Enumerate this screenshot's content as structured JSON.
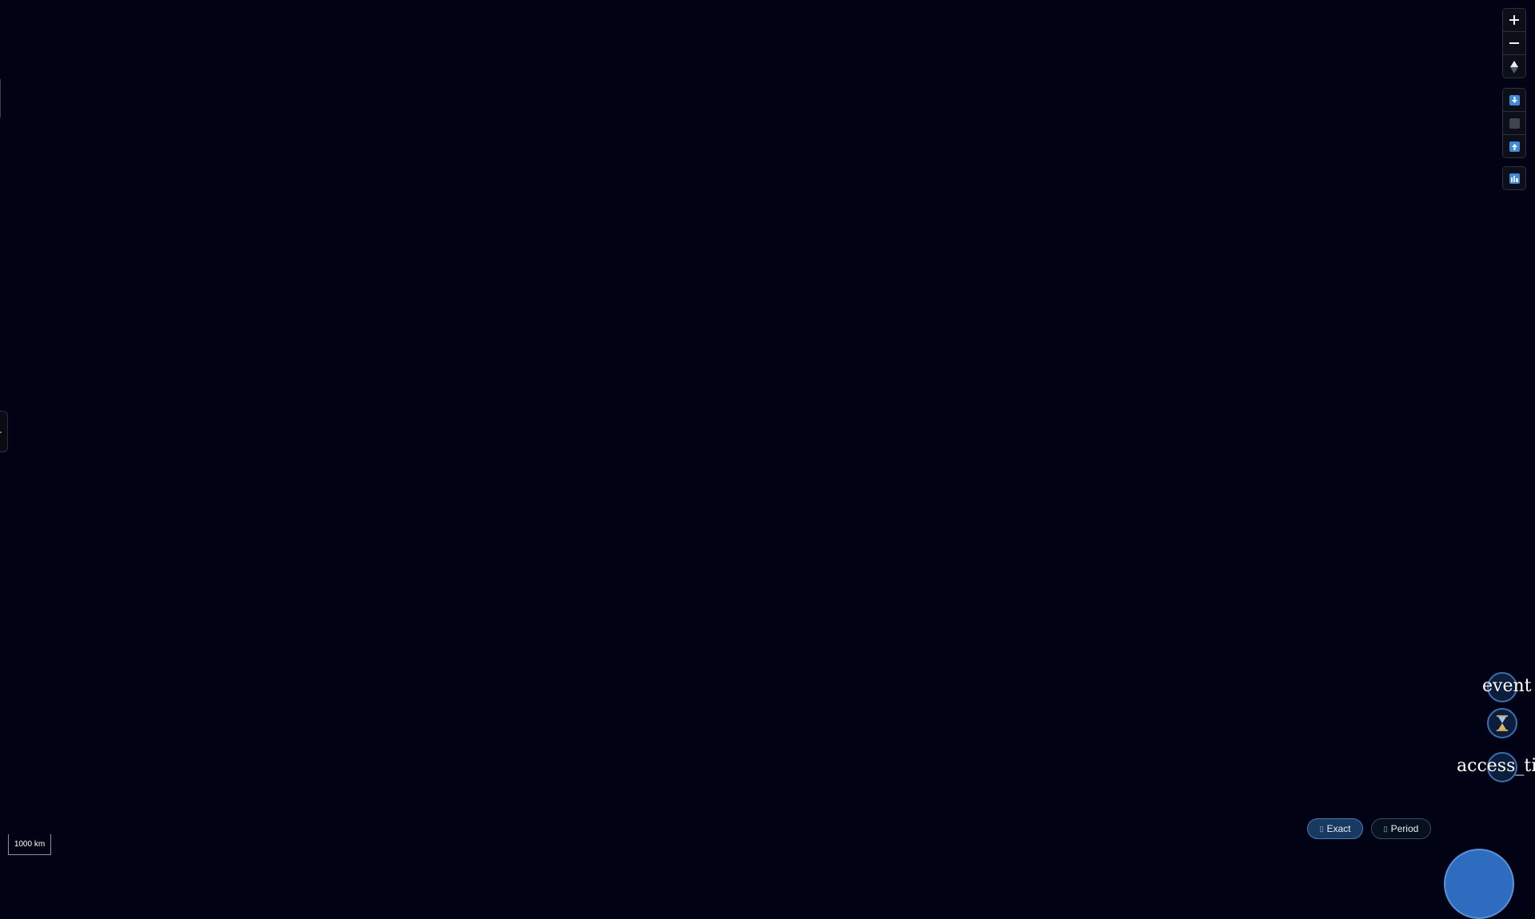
{
  "map": {
    "scale_label": "1000 km"
  },
  "controls": {
    "zoom_in_icon": "plus-icon",
    "zoom_out_icon": "minus-icon",
    "compass_icon": "compass-icon",
    "download_icon": "download-icon",
    "stop_icon": "stop-icon",
    "upload_icon": "upload-icon",
    "skyline_icon": "skyline-icon"
  },
  "nodes": {
    "event_label": "event",
    "hourglass_icon": "hourglass-icon",
    "access_label": "access_tim"
  },
  "time_mode": {
    "exact_label": "Exact",
    "period_label": "Period",
    "selected": "Exact"
  },
  "colors": {
    "background": "#020215",
    "accent": "#3f8ad8",
    "node_border": "#3c6fb0"
  }
}
